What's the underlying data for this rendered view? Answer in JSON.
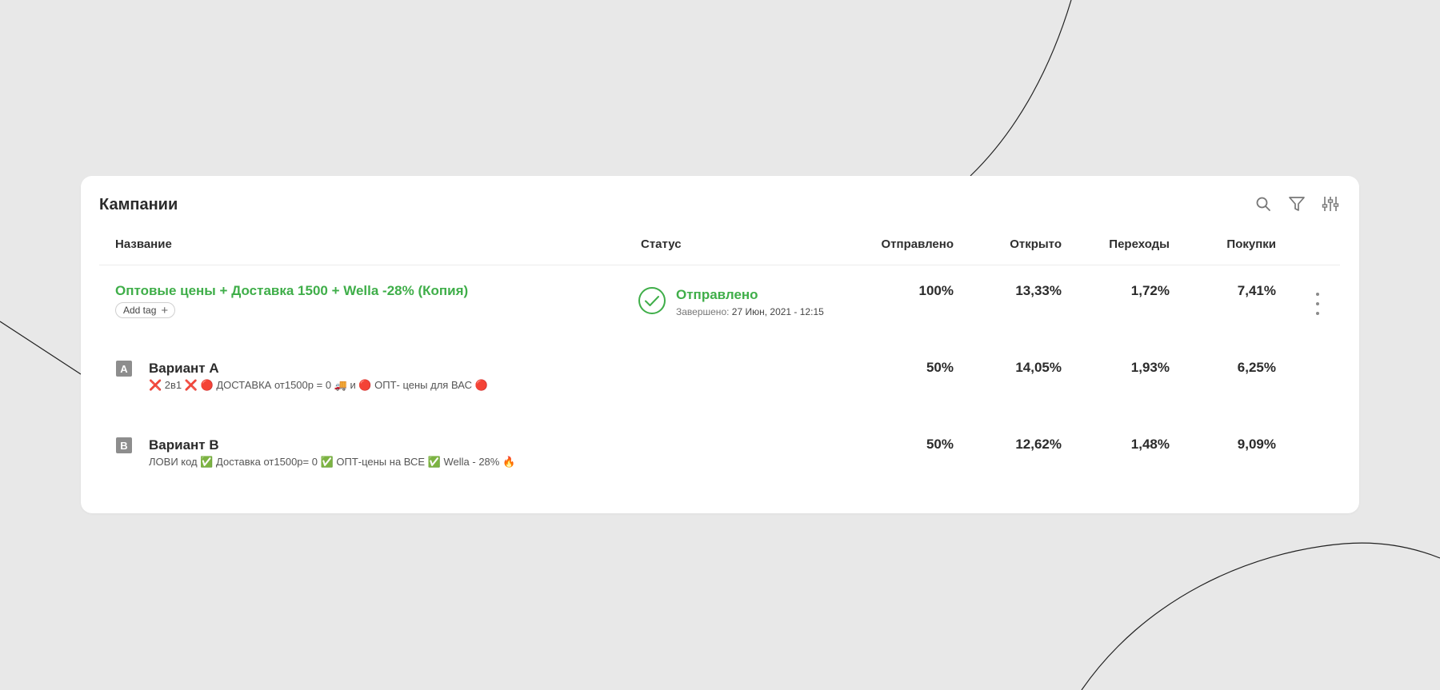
{
  "card": {
    "title": "Кампании"
  },
  "toolbar": {
    "icons": [
      "search-icon",
      "filter-icon",
      "sliders-icon"
    ]
  },
  "table": {
    "headers": {
      "name": "Название",
      "status": "Статус",
      "sent": "Отправлено",
      "opened": "Открыто",
      "clicks": "Переходы",
      "purchases": "Покупки"
    },
    "campaign": {
      "name": "Оптовые цены + Доставка 1500 + Wella -28% (Копия)",
      "add_tag": "Add tag",
      "status_label": "Отправлено",
      "status_prefix": "Завершено:",
      "status_date": "27 Июн, 2021 - 12:15",
      "sent": "100%",
      "opened": "13,33%",
      "clicks": "1,72%",
      "purchases": "7,41%"
    },
    "variants": [
      {
        "badge": "A",
        "title": "Вариант A",
        "subject": "❌ 2в1 ❌ 🔴 ДОСТАВКА от1500р = 0 🚚 и 🔴 ОПТ- цены для ВАС 🔴",
        "sent": "50%",
        "opened": "14,05%",
        "clicks": "1,93%",
        "purchases": "6,25%"
      },
      {
        "badge": "B",
        "title": "Вариант B",
        "subject": "ЛОВИ код ✅ Доставка от1500р= 0 ✅ ОПТ-цены на ВСЕ ✅ Wella - 28% 🔥",
        "sent": "50%",
        "opened": "12,62%",
        "clicks": "1,48%",
        "purchases": "9,09%"
      }
    ]
  },
  "colors": {
    "accent_green": "#3fae49",
    "background": "#e8e8e8",
    "card": "#ffffff",
    "badge_gray": "#8d8d8d"
  }
}
